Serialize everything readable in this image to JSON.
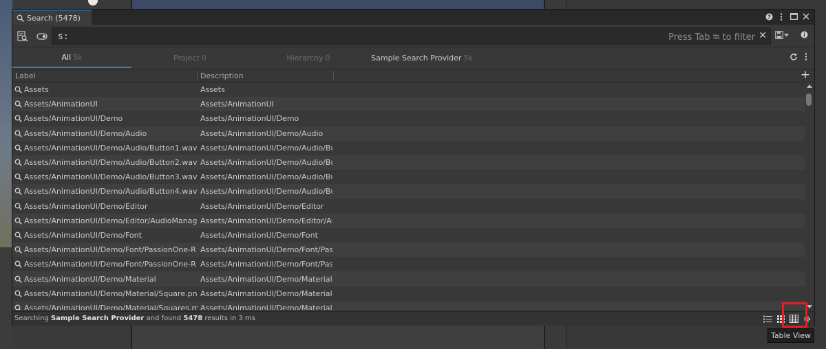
{
  "window": {
    "title": "Search (5478)",
    "help_icon": "help-icon",
    "more_icon": "more-vertical-icon",
    "maximize_icon": "maximize-icon",
    "close_icon": "close-icon"
  },
  "searchbar": {
    "query": "s:",
    "filter_hint": "Press Tab ⭾ to filter",
    "clear_label": "✕"
  },
  "tabs": [
    {
      "label": "All",
      "count": "5k"
    },
    {
      "label": "Project",
      "count": "0"
    },
    {
      "label": "Hierarchy",
      "count": "0"
    },
    {
      "label": "Sample Search Provider",
      "count": "5k"
    }
  ],
  "columns": {
    "label": "Label",
    "description": "Description"
  },
  "rows": [
    {
      "label": "Assets",
      "description": "Assets"
    },
    {
      "label": "Assets/AnimationUI",
      "description": "Assets/AnimationUI"
    },
    {
      "label": "Assets/AnimationUI/Demo",
      "description": "Assets/AnimationUI/Demo"
    },
    {
      "label": "Assets/AnimationUI/Demo/Audio",
      "description": "Assets/AnimationUI/Demo/Audio"
    },
    {
      "label": "Assets/AnimationUI/Demo/Audio/Button1.wav",
      "description": "Assets/AnimationUI/Demo/Audio/Bu"
    },
    {
      "label": "Assets/AnimationUI/Demo/Audio/Button2.wav",
      "description": "Assets/AnimationUI/Demo/Audio/Bu"
    },
    {
      "label": "Assets/AnimationUI/Demo/Audio/Button3.wav",
      "description": "Assets/AnimationUI/Demo/Audio/Bu"
    },
    {
      "label": "Assets/AnimationUI/Demo/Audio/Button4.wav",
      "description": "Assets/AnimationUI/Demo/Audio/Bu"
    },
    {
      "label": "Assets/AnimationUI/Demo/Editor",
      "description": "Assets/AnimationUI/Demo/Editor"
    },
    {
      "label": "Assets/AnimationUI/Demo/Editor/AudioManag",
      "description": "Assets/AnimationUI/Demo/Editor/Au"
    },
    {
      "label": "Assets/AnimationUI/Demo/Font",
      "description": "Assets/AnimationUI/Demo/Font"
    },
    {
      "label": "Assets/AnimationUI/Demo/Font/PassionOne-R",
      "description": "Assets/AnimationUI/Demo/Font/Pas"
    },
    {
      "label": "Assets/AnimationUI/Demo/Font/PassionOne-R",
      "description": "Assets/AnimationUI/Demo/Font/Pas"
    },
    {
      "label": "Assets/AnimationUI/Demo/Material",
      "description": "Assets/AnimationUI/Demo/Material"
    },
    {
      "label": "Assets/AnimationUI/Demo/Material/Square.pn",
      "description": "Assets/AnimationUI/Demo/Material"
    },
    {
      "label": "Assets/AnimationUI/Demo/Material/Squares.m",
      "description": "Assets/AnimationUI/Demo/Material"
    }
  ],
  "status": {
    "prefix": "Searching ",
    "provider": "Sample Search Provider",
    "middle": " and found ",
    "count": "5478",
    "suffix": " results in 3 ms"
  },
  "view_buttons": [
    "list-view-icon",
    "grid-view-icon",
    "table-view-icon",
    "settings-icon"
  ],
  "tooltip": "Table View",
  "colors": {
    "accent": "#3d7bc4",
    "highlight": "#e41e26"
  }
}
